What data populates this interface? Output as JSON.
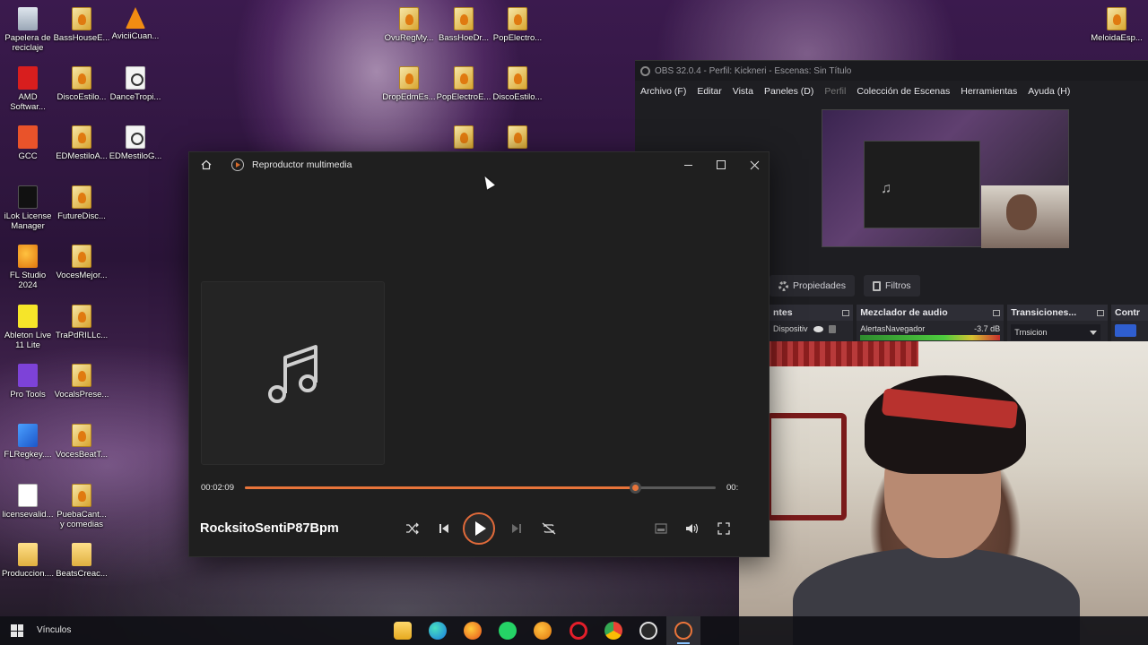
{
  "desktop": {
    "icons": [
      {
        "label": "Papelera de reciclaje",
        "icon": "recycle-bin-icon"
      },
      {
        "label": "BassHouseE...",
        "icon": "flp-file-icon"
      },
      {
        "label": "AviciiCuan...",
        "icon": "vlc-icon"
      },
      {
        "label": "OvuRegMy...",
        "icon": "flp-file-icon"
      },
      {
        "label": "BassHoeDr...",
        "icon": "flp-file-icon"
      },
      {
        "label": "PopElectro...",
        "icon": "flp-file-icon"
      },
      {
        "label": "MeloidaEsp...",
        "icon": "flp-file-icon"
      },
      {
        "label": "AMD Softwar...",
        "icon": "amd-icon"
      },
      {
        "label": "DiscoEstilo...",
        "icon": "flp-file-icon"
      },
      {
        "label": "DanceTropi...",
        "icon": "media-file-icon"
      },
      {
        "label": "DropEdmEs...",
        "icon": "flp-file-icon"
      },
      {
        "label": "PopElectroE...",
        "icon": "flp-file-icon"
      },
      {
        "label": "DiscoEstilo...",
        "icon": "flp-file-icon"
      },
      {
        "label": "GCC",
        "icon": "gcc-icon"
      },
      {
        "label": "EDMestiloA...",
        "icon": "flp-file-icon"
      },
      {
        "label": "EDMestiloG...",
        "icon": "media-file-icon"
      },
      {
        "label": "iLok License Manager",
        "icon": "ilok-icon"
      },
      {
        "label": "FutureDisc...",
        "icon": "flp-file-icon"
      },
      {
        "label": "FL Studio 2024",
        "icon": "fl-studio-icon"
      },
      {
        "label": "VocesMejor...",
        "icon": "flp-file-icon"
      },
      {
        "label": "Ableton Live 11 Lite",
        "icon": "ableton-icon"
      },
      {
        "label": "TraPdRILLc...",
        "icon": "flp-file-icon"
      },
      {
        "label": "Pro Tools",
        "icon": "pro-tools-icon"
      },
      {
        "label": "VocalsPrese...",
        "icon": "flp-file-icon"
      },
      {
        "label": "FLRegkey....",
        "icon": "regkey-icon"
      },
      {
        "label": "VocesBeatT...",
        "icon": "flp-file-icon"
      },
      {
        "label": "licensevalid...",
        "icon": "text-file-icon"
      },
      {
        "label": "PuebaCant... y comedias",
        "icon": "flp-file-icon"
      },
      {
        "label": "Produccion....",
        "icon": "folder-icon"
      },
      {
        "label": "BeatsCreac...",
        "icon": "folder-icon"
      }
    ]
  },
  "obs": {
    "title": "OBS 32.0.4 - Perfil: Kickneri - Escenas: Sin Título",
    "menu": [
      "Archivo (F)",
      "Editar",
      "Vista",
      "Paneles (D)",
      "Perfil",
      "Colección de Escenas",
      "Herramientas",
      "Ayuda (H)"
    ],
    "properties_label": "Propiedades",
    "filters_label": "Filtros",
    "docks": {
      "sources_header": "ntes",
      "source_item": "Dispositiv",
      "mixer_header": "Mezclador de audio",
      "mixer_channel": "AlertasNavegador",
      "mixer_level": "-3.7 dB",
      "transitions_header": "Transiciones...",
      "transition_value": "Trnsicion",
      "controls_header": "Contr"
    }
  },
  "player": {
    "app_title": "Reproductor multimedia",
    "current_time": "00:02:09",
    "remaining_time": "00:",
    "progress": 0.829,
    "track_title": "RocksitoSentiP87Bpm",
    "accent_color": "#e8743a"
  },
  "taskbar": {
    "links_label": "Vínculos",
    "apps": [
      "file-explorer-icon",
      "edge-icon",
      "firefox-icon",
      "whatsapp-icon",
      "fl-studio-icon",
      "opera-icon",
      "chrome-icon",
      "obs-icon",
      "media-player-icon"
    ]
  }
}
